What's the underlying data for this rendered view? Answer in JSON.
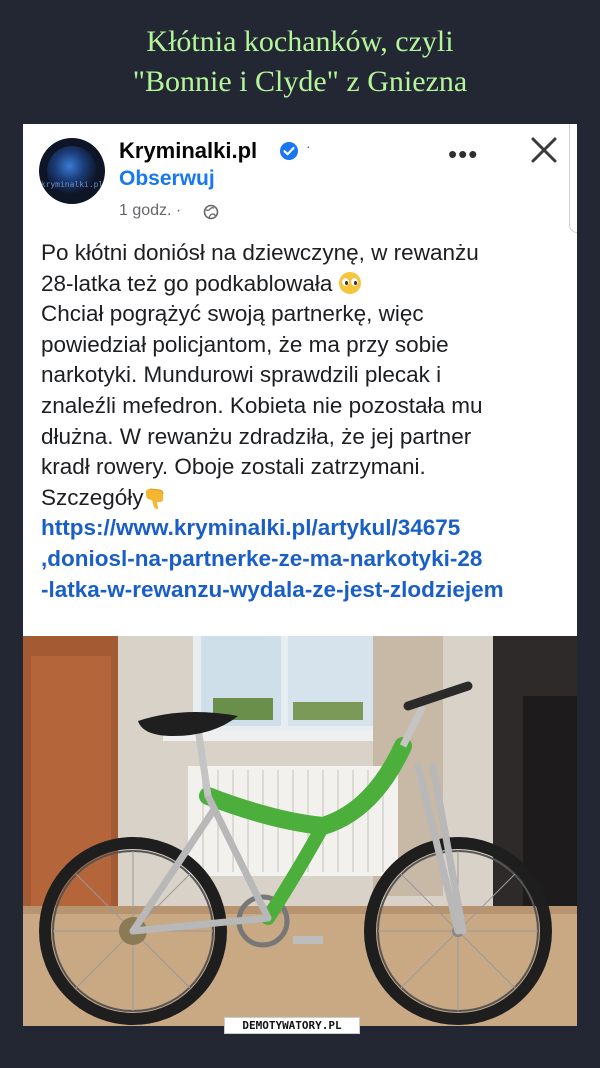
{
  "meme": {
    "title_line1": "Kłótnia kochanków, czyli",
    "title_line2": "\"Bonnie i Clyde\" z Gniezna",
    "watermark": "DEMOTYWATORY.PL"
  },
  "post": {
    "avatar_text": "kryminalki.pl",
    "page_name": "Kryminalki.pl",
    "follow_label": "Obserwuj",
    "time_label": "1 godz. ·",
    "separator": "·",
    "more_label": "•••",
    "text_lines": [
      "Po kłótni doniósł na dziewczynę, w rewanżu",
      "28-latka też go podkablowała",
      "Chciał pogrążyć swoją partnerkę, więc",
      "powiedział policjantom, że ma przy sobie",
      "narkotyki. Mundurowi sprawdzili plecak i",
      "znaleźli mefedron. Kobieta nie pozostała mu",
      "dłużna. W rewanżu zdradziła, że jej partner",
      "kradł rowery. Oboje zostali zatrzymani.",
      "Szczegóły"
    ],
    "link_lines": [
      "https://www.kryminalki.pl/artykul/34675",
      ",doniosl-na-partnerke-ze-ma-narkotyki-28",
      "-latka-w-rewanzu-wydala-ze-jest-zlodziejem"
    ],
    "icons": [
      "verified-badge-icon",
      "globe-icon",
      "more-icon",
      "close-icon",
      "pleading-face-emoji",
      "backhand-pointing-down-emoji"
    ]
  },
  "colors": {
    "background": "#232734",
    "title": "#b4f59a",
    "link": "#1a5fc8",
    "follow": "#1877f2",
    "bike_frame": "#4caf3c"
  }
}
